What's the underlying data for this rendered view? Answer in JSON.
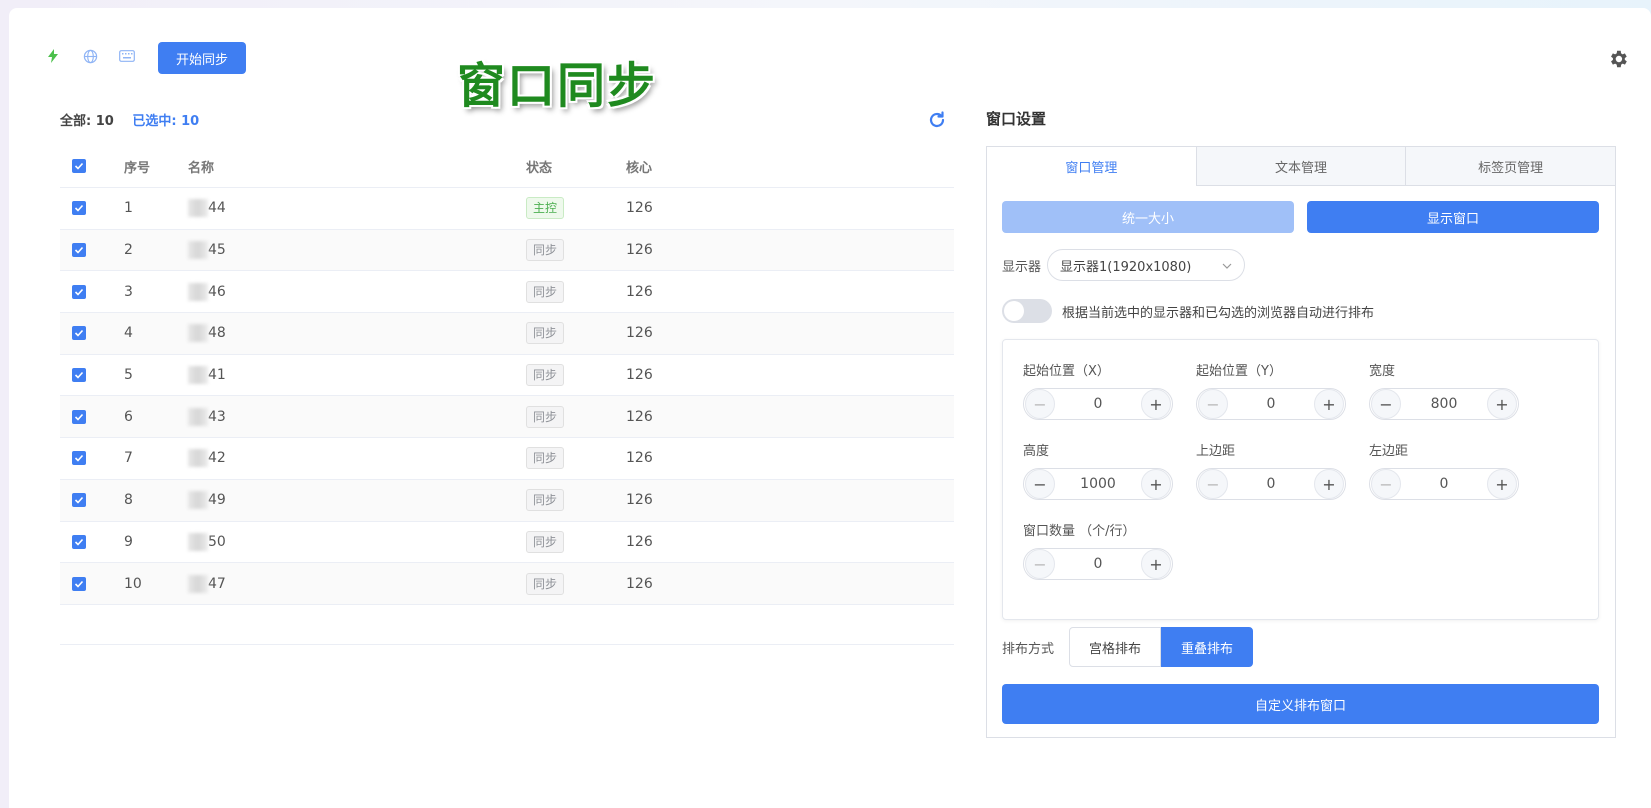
{
  "toolbar": {
    "start_sync_label": "开始同步",
    "page_banner": "窗口同步",
    "icons": [
      "bolt-icon",
      "globe-icon",
      "keyboard-icon",
      "gear-icon"
    ]
  },
  "summary": {
    "total_label": "全部: 10",
    "selected_label": "已选中: 10"
  },
  "table": {
    "columns": [
      "序号",
      "名称",
      "状态",
      "核心"
    ],
    "rows": [
      {
        "index": "1",
        "name": "44",
        "status": "主控",
        "core": "126"
      },
      {
        "index": "2",
        "name": "45",
        "status": "同步",
        "core": "126"
      },
      {
        "index": "3",
        "name": "46",
        "status": "同步",
        "core": "126"
      },
      {
        "index": "4",
        "name": "48",
        "status": "同步",
        "core": "126"
      },
      {
        "index": "5",
        "name": "41",
        "status": "同步",
        "core": "126"
      },
      {
        "index": "6",
        "name": "43",
        "status": "同步",
        "core": "126"
      },
      {
        "index": "7",
        "name": "42",
        "status": "同步",
        "core": "126"
      },
      {
        "index": "8",
        "name": "49",
        "status": "同步",
        "core": "126"
      },
      {
        "index": "9",
        "name": "50",
        "status": "同步",
        "core": "126"
      },
      {
        "index": "10",
        "name": "47",
        "status": "同步",
        "core": "126"
      }
    ]
  },
  "settings": {
    "title": "窗口设置",
    "tabs": [
      "窗口管理",
      "文本管理",
      "标签页管理"
    ],
    "uniform_size_label": "统一大小",
    "show_window_label": "显示窗口",
    "display_label": "显示器",
    "display_value": "显示器1(1920x1080)",
    "auto_arrange_label": "根据当前选中的显示器和已勾选的浏览器自动进行排布",
    "fields": {
      "start_x": {
        "label": "起始位置（X）",
        "value": "0"
      },
      "start_y": {
        "label": "起始位置（Y）",
        "value": "0"
      },
      "width": {
        "label": "宽度",
        "value": "800"
      },
      "height": {
        "label": "高度",
        "value": "1000"
      },
      "top_margin": {
        "label": "上边距",
        "value": "0"
      },
      "left_margin": {
        "label": "左边距",
        "value": "0"
      },
      "per_row": {
        "label": "窗口数量 （个/行）",
        "value": "0"
      }
    },
    "layout_label": "排布方式",
    "layout_options": [
      "宫格排布",
      "重叠排布"
    ],
    "custom_arrange_label": "自定义排布窗口"
  },
  "colors": {
    "accent": "#3f7ef2",
    "banner_green": "#1f8a1f",
    "master_green": "#4caf50"
  }
}
